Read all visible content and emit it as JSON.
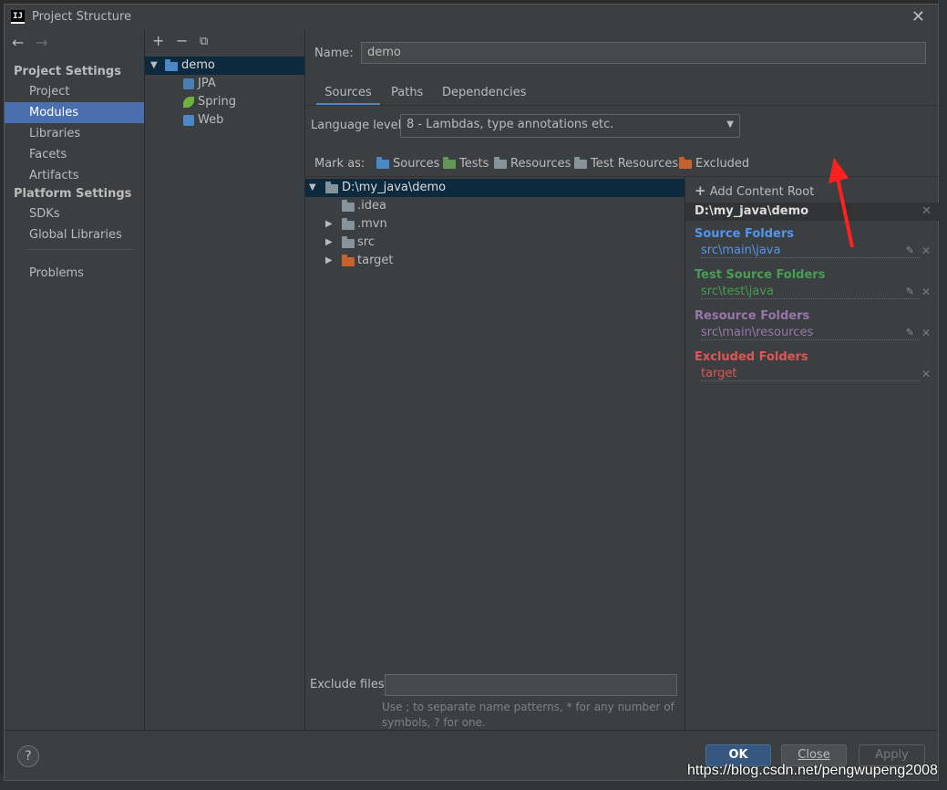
{
  "window": {
    "title": "Project Structure"
  },
  "nav": {
    "back": "←",
    "forward": "→"
  },
  "sidebar": {
    "project_settings": "Project Settings",
    "platform_settings": "Platform Settings",
    "items": [
      {
        "label": "Project"
      },
      {
        "label": "Modules",
        "selected": true
      },
      {
        "label": "Libraries"
      },
      {
        "label": "Facets"
      },
      {
        "label": "Artifacts"
      },
      {
        "label": "SDKs"
      },
      {
        "label": "Global Libraries"
      },
      {
        "label": "Problems"
      }
    ]
  },
  "module_toolbar": {
    "add": "+",
    "remove": "−",
    "copy": "⧉"
  },
  "module_tree": {
    "root": "demo",
    "children": [
      "JPA",
      "Spring",
      "Web"
    ]
  },
  "main": {
    "name_label": "Name:",
    "name_value": "demo",
    "tabs": [
      "Sources",
      "Paths",
      "Dependencies"
    ],
    "language_level_label": "Language level:",
    "language_level_value": "8 - Lambdas, type annotations etc.",
    "mark_as_label": "Mark as:",
    "mark_as": [
      "Sources",
      "Tests",
      "Resources",
      "Test Resources",
      "Excluded"
    ],
    "tree": {
      "root": "D:\\my_java\\demo",
      "children": [
        ".idea",
        ".mvn",
        "src",
        "target"
      ]
    },
    "exclude_label": "Exclude files:",
    "exclude_value": "",
    "exclude_hint": "Use ; to separate name patterns, * for any number of symbols, ? for one."
  },
  "content_root": {
    "add_label": "Add Content Root",
    "path": "D:\\my_java\\demo",
    "groups": [
      {
        "title": "Source Folders",
        "item": "src\\main\\java",
        "color": "#5394ec"
      },
      {
        "title": "Test Source Folders",
        "item": "src\\test\\java",
        "color": "#499c54"
      },
      {
        "title": "Resource Folders",
        "item": "src\\main\\resources",
        "color": "#9876aa"
      },
      {
        "title": "Excluded Folders",
        "item": "target",
        "color": "#e05555"
      }
    ]
  },
  "footer": {
    "help": "?",
    "ok": "OK",
    "close": "Close",
    "apply": "Apply"
  },
  "watermark": "https://blog.csdn.net/pengwupeng2008"
}
